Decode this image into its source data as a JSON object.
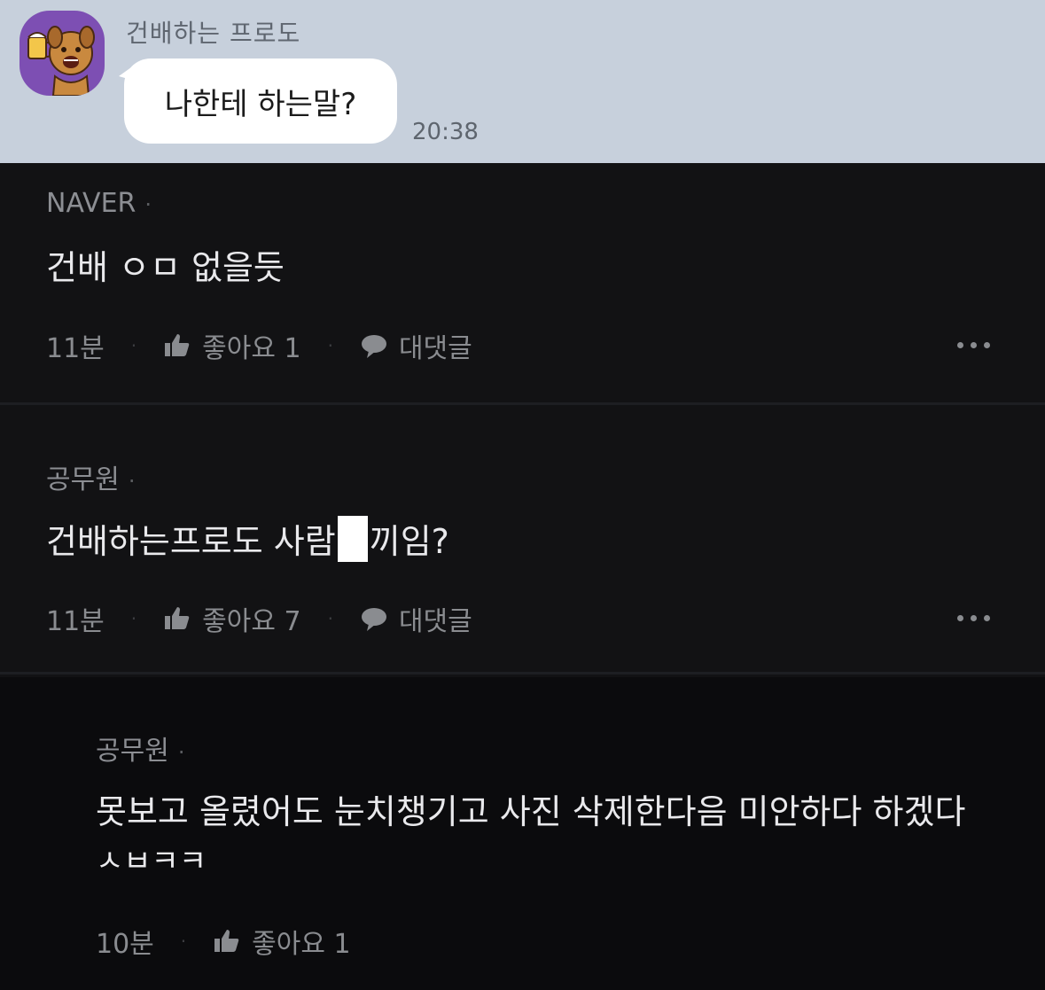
{
  "chat": {
    "sender": "건배하는 프로도",
    "message": "나한테 하는말?",
    "time": "20:38",
    "accent_color": "#7d4fb3"
  },
  "comments": [
    {
      "author": "NAVER",
      "text": "건배 ㅇㅁ 없을듯",
      "time": "11분",
      "like_label": "좋아요 1",
      "reply_label": "대댓글"
    },
    {
      "author": "공무원",
      "text_before": "건배하는프로도 사람",
      "text_after": "끼임?",
      "time": "11분",
      "like_label": "좋아요 7",
      "reply_label": "대댓글"
    },
    {
      "author": "공무원",
      "text_line1": "못보고 올렸어도 눈치챙기고 사진 삭제한다음 미안하다 하겠다",
      "text_line2": "ㅅㅂㅋㅋ",
      "time": "10분",
      "like_label": "좋아요 1"
    }
  ],
  "separator_dot": "·",
  "icons": [
    "beer-character-avatar",
    "thumbs-up-icon",
    "speech-bubble-icon",
    "more-dots-icon"
  ]
}
